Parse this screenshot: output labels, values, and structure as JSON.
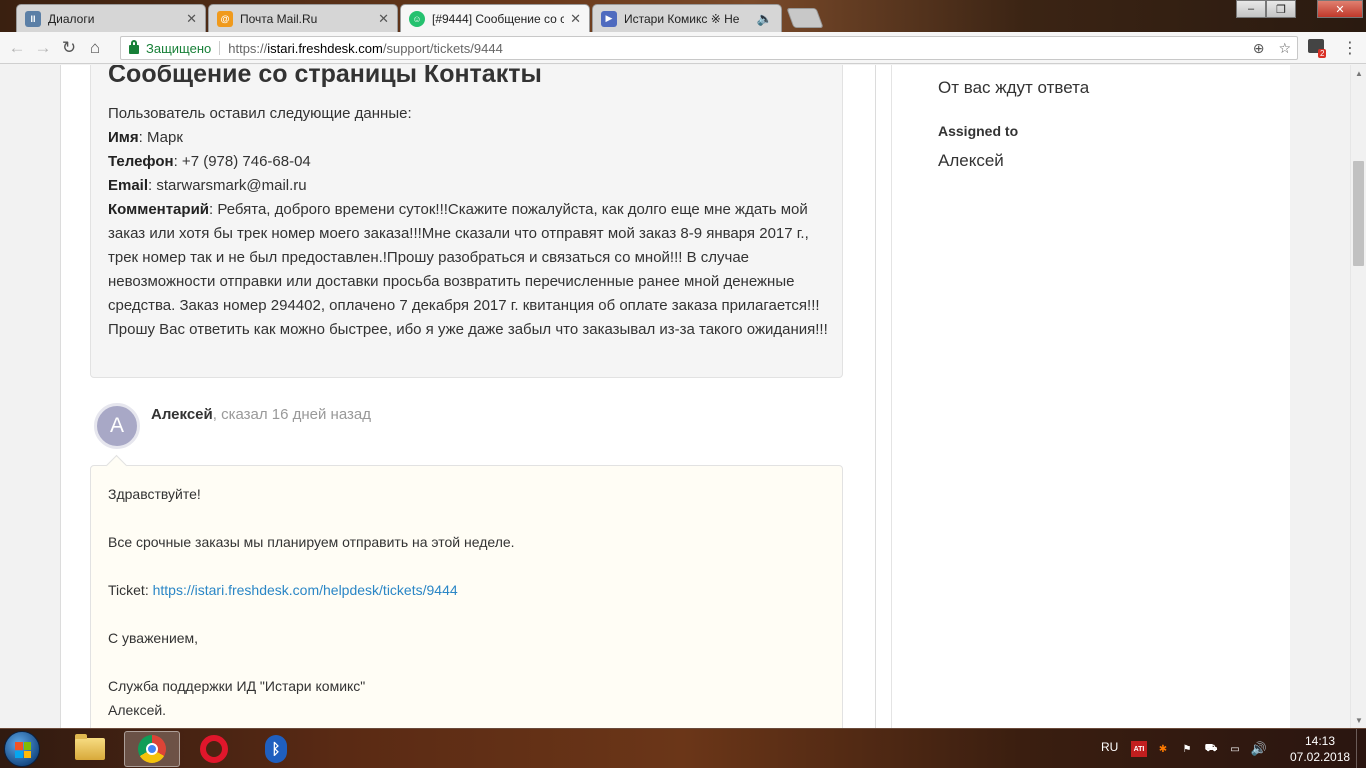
{
  "browser": {
    "tabs": [
      {
        "title": "Диалоги",
        "favicon_color": "#5b7fa6",
        "favicon_text": "II"
      },
      {
        "title": "Почта Mail.Ru",
        "favicon_color": "#f09a1c",
        "favicon_text": "@"
      },
      {
        "title": "[#9444] Сообщение со с",
        "favicon_color": "#25c16f",
        "favicon_text": "☺"
      },
      {
        "title": "Истари Комикс ※ Не",
        "favicon_color": "#4f6bbf",
        "favicon_text": "▶"
      }
    ],
    "active_tab_index": 2,
    "window_controls": {
      "minimize": "–",
      "maximize": "❐",
      "close": "✕"
    },
    "secure_label": "Защищено",
    "url_scheme": "https://",
    "url_host": "istari.freshdesk.com",
    "url_path": "/support/tickets/9444",
    "extension_badge": "2"
  },
  "ticket": {
    "title": "Сообщение со страницы Контакты",
    "intro": "Пользователь оставил следующие данные:",
    "fields": [
      {
        "label": "Имя",
        "value": ": Марк"
      },
      {
        "label": "Телефон",
        "value": ": +7 (978) 746-68-04"
      },
      {
        "label": "Email",
        "value": ": starwarsmark@mail.ru"
      }
    ],
    "comment_label": "Комментарий",
    "comment_text": ": Ребята, доброго времени суток!!!Скажите пожалуйста, как долго еще мне ждать мой заказ или хотя бы трек номер моего заказа!!!Мне сказали что отправят мой заказ 8-9 января 2017 г., трек номер так и не был предоставлен.!Прошу разобраться и связаться со мной!!! В случае невозможности отправки или доставки просьба возвратить перечисленные ранее мной денежные средства. Заказ номер 294402, оплачено 7 декабря 2017 г. квитанция об оплате заказа прилагается!!!Прошу Вас ответить как можно быстрее, ибо я уже даже забыл что заказывал из-за такого ожидания!!!"
  },
  "reply": {
    "avatar_letter": "А",
    "author": "Алексей",
    "meta": ", сказал 16 дней назад",
    "greeting": "Здравствуйте!",
    "line1": "Все срочные заказы мы планируем отправить на этой неделе.",
    "ticket_label": "Ticket: ",
    "ticket_link": "https://istari.freshdesk.com/helpdesk/tickets/9444",
    "regards": "С уважением,",
    "signature1": "Служба поддержки ИД \"Истари комикс\"",
    "signature2": "Алексей."
  },
  "sidebar": {
    "status_value": "От вас ждут ответа",
    "assigned_label": "Assigned to",
    "assigned_value": "Алексей"
  },
  "taskbar": {
    "lang": "RU",
    "time": "14:13",
    "date": "07.02.2018"
  }
}
